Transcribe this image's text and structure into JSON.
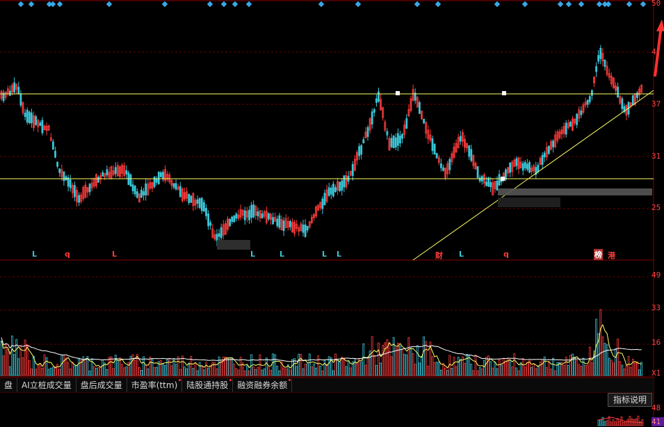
{
  "colors": {
    "up": "#ff3b3b",
    "down": "#39c6d8",
    "grid": "#6a0000",
    "yellow": "#ffff66",
    "white": "#ffffff",
    "background": "#000000"
  },
  "price_axis": [
    "50",
    "4",
    "4",
    "37",
    "31",
    "25"
  ],
  "volume_axis": [
    "49",
    "33",
    "16",
    "X1"
  ],
  "bottom_axis": [
    "48",
    "41"
  ],
  "markers": [
    {
      "text": "L",
      "color": "#39c6d8"
    },
    {
      "text": "q",
      "color": "#ff3b3b"
    },
    {
      "text": "L",
      "color": "#ff3b3b"
    },
    {
      "text": "L",
      "color": "#39c6d8"
    },
    {
      "text": "L",
      "color": "#39c6d8"
    },
    {
      "text": "L",
      "color": "#39c6d8"
    },
    {
      "text": "L",
      "color": "#39c6d8"
    },
    {
      "text": "财",
      "color": "#ff3b3b"
    },
    {
      "text": "L",
      "color": "#39c6d8"
    },
    {
      "text": "q",
      "color": "#ff3b3b"
    },
    {
      "text": "榜",
      "color": "#ffffff"
    },
    {
      "text": "港",
      "color": "#ff3b3b"
    }
  ],
  "tabs": [
    "盘",
    "AI立桩成交量",
    "盘后成交量",
    "市盈率(ttm)",
    "陆股通持股",
    "融资融券余额"
  ],
  "tab_dots": [
    false,
    false,
    false,
    true,
    true,
    true
  ],
  "help_button": "指标说明"
}
